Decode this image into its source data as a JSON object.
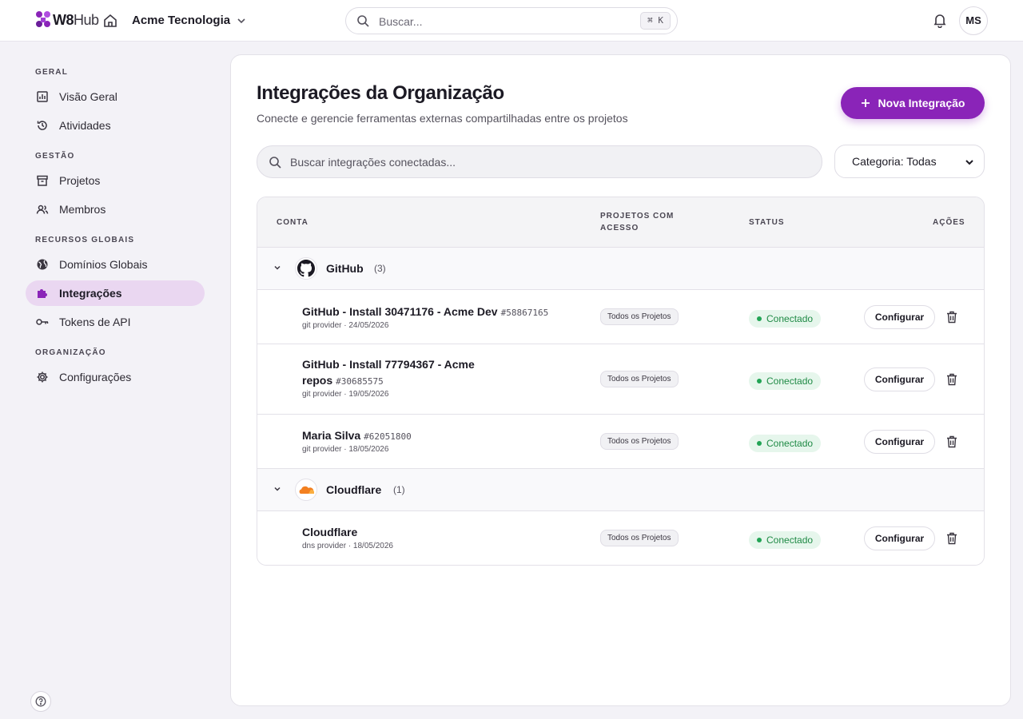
{
  "brand": {
    "name_bold": "W8",
    "name_rest": "Hub",
    "accent": "#8a24b8"
  },
  "topbar": {
    "org_name": "Acme Tecnologia",
    "search_placeholder": "Buscar...",
    "search_shortcut": "⌘ K",
    "avatar_initials": "MS"
  },
  "sidebar": {
    "sections": [
      {
        "title": "GERAL",
        "items": [
          {
            "label": "Visão Geral",
            "icon": "chart-icon"
          },
          {
            "label": "Atividades",
            "icon": "history-icon"
          }
        ]
      },
      {
        "title": "GESTÃO",
        "items": [
          {
            "label": "Projetos",
            "icon": "archive-icon"
          },
          {
            "label": "Membros",
            "icon": "users-icon"
          }
        ]
      },
      {
        "title": "RECURSOS GLOBAIS",
        "items": [
          {
            "label": "Domínios Globais",
            "icon": "globe-icon"
          },
          {
            "label": "Integrações",
            "icon": "puzzle-icon",
            "active": true
          },
          {
            "label": "Tokens de API",
            "icon": "key-icon"
          }
        ]
      },
      {
        "title": "ORGANIZAÇÃO",
        "items": [
          {
            "label": "Configurações",
            "icon": "gear-icon"
          }
        ]
      }
    ]
  },
  "page": {
    "title": "Integrações da Organização",
    "subtitle": "Conecte e gerencie ferramentas externas compartilhadas entre os projetos",
    "new_button": "Nova Integração",
    "search_placeholder": "Buscar integrações conectadas...",
    "category_filter": "Categoria: Todas"
  },
  "table": {
    "headers": {
      "account": "CONTA",
      "projects_line1": "PROJETOS COM",
      "projects_line2": "ACESSO",
      "status": "STATUS",
      "actions": "AÇÕES"
    },
    "groups": [
      {
        "name": "GitHub",
        "count": "(3)",
        "icon": "github-icon",
        "rows": [
          {
            "name": "GitHub - Install 30471176 - Acme Dev",
            "id": "#58867165",
            "meta": "git provider · 24/05/2026",
            "projects": "Todos os Projetos",
            "status": "Conectado",
            "action": "Configurar"
          },
          {
            "name_line1": "GitHub - Install 77794367 - Acme",
            "name_line2": "repos",
            "id": "#30685575",
            "meta": "git provider · 19/05/2026",
            "projects": "Todos os Projetos",
            "status": "Conectado",
            "action": "Configurar"
          },
          {
            "name": "Maria Silva",
            "id": "#62051800",
            "meta": "git provider · 18/05/2026",
            "projects": "Todos os Projetos",
            "status": "Conectado",
            "action": "Configurar"
          }
        ]
      },
      {
        "name": "Cloudflare",
        "count": "(1)",
        "icon": "cloudflare-icon",
        "rows": [
          {
            "name": "Cloudflare",
            "meta": "dns provider · 18/05/2026",
            "projects": "Todos os Projetos",
            "status": "Conectado",
            "action": "Configurar"
          }
        ]
      }
    ]
  }
}
